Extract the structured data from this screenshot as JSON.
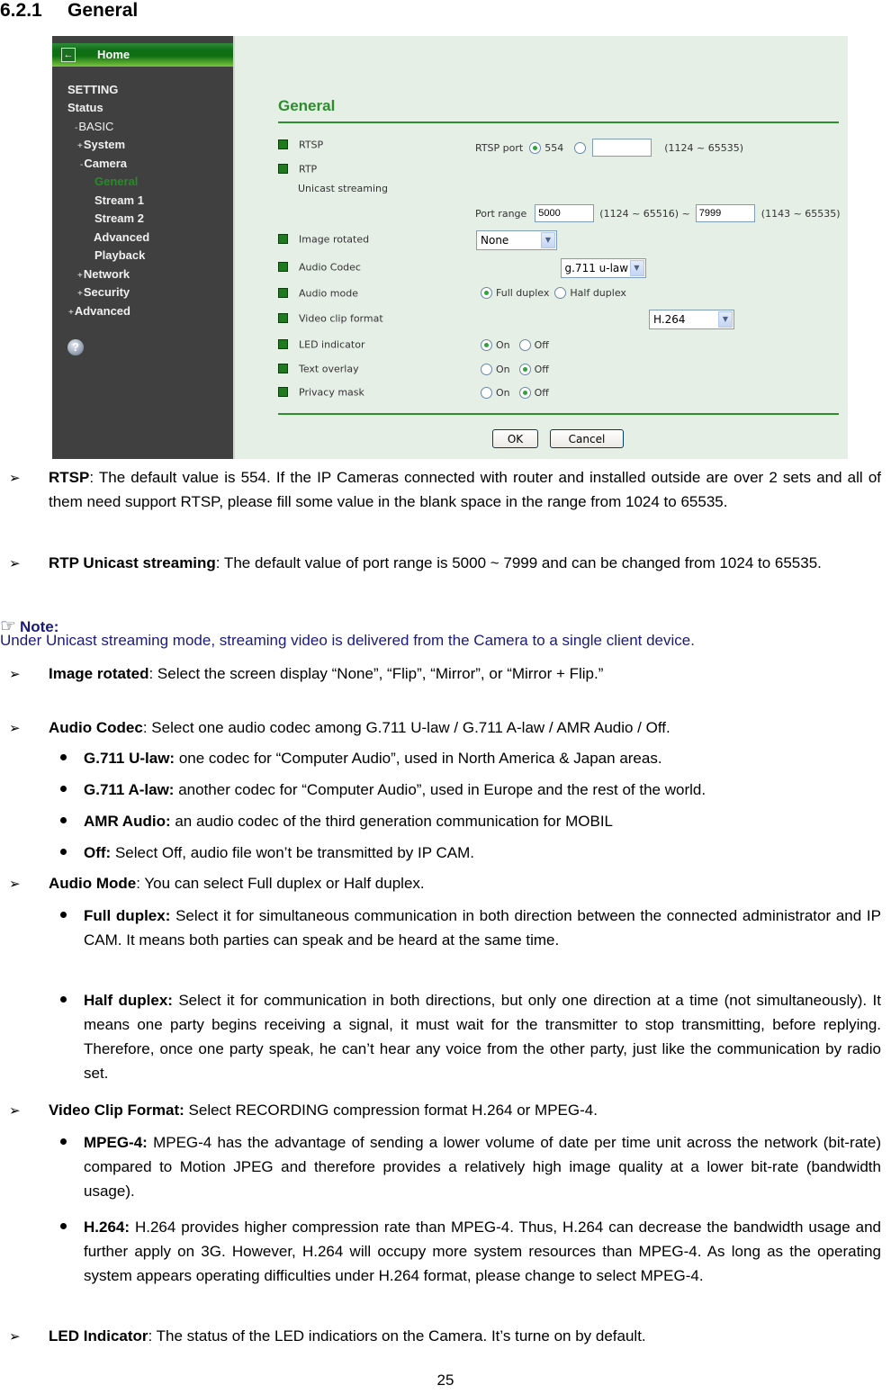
{
  "section": {
    "number": "6.2.1",
    "title": "General"
  },
  "screenshot": {
    "sidebar": {
      "home_label": "Home",
      "home_icon": "back-arrow-icon",
      "items": [
        {
          "prefix": "",
          "label": "SETTING",
          "active": false
        },
        {
          "prefix": "",
          "label": "Status",
          "active": false
        },
        {
          "prefix": "-",
          "label": "BASIC",
          "active": false
        },
        {
          "prefix": "+",
          "label": "System",
          "active": false
        },
        {
          "prefix": "-",
          "label": "Camera",
          "active": false
        },
        {
          "prefix": "",
          "label": "General",
          "active": true
        },
        {
          "prefix": "",
          "label": "Stream 1",
          "active": false
        },
        {
          "prefix": "",
          "label": "Stream 2",
          "active": false
        },
        {
          "prefix": "",
          "label": "Advanced",
          "active": false
        },
        {
          "prefix": "",
          "label": "Playback",
          "active": false
        },
        {
          "prefix": "+",
          "label": "Network",
          "active": false
        },
        {
          "prefix": "+",
          "label": "Security",
          "active": false
        },
        {
          "prefix": "+",
          "label": "Advanced",
          "active": false
        }
      ],
      "help_icon": "help-question-icon",
      "help_glyph": "?"
    },
    "form": {
      "heading": "General",
      "rtsp": {
        "label": "RTSP",
        "port_label": "RTSP port",
        "default_port": "554",
        "default_selected": true,
        "custom_value": "",
        "range_hint": "(1124 ~ 65535)"
      },
      "rtp": {
        "label": "RTP",
        "sub_label": "Unicast streaming",
        "port_range_label": "Port range",
        "start": "5000",
        "start_hint": "(1124 ~ 65516) ~",
        "end": "7999",
        "end_hint": "(1143 ~ 65535)"
      },
      "image_rotated": {
        "label": "Image rotated",
        "value": "None"
      },
      "audio_codec": {
        "label": "Audio Codec",
        "value": "g.711 u-law"
      },
      "audio_mode": {
        "label": "Audio mode",
        "options": [
          "Full duplex",
          "Half duplex"
        ],
        "selected": "Full duplex"
      },
      "video_clip_format": {
        "label": "Video clip format",
        "value": "H.264"
      },
      "led_indicator": {
        "label": "LED indicator",
        "on_label": "On",
        "off_label": "Off",
        "selected": "On"
      },
      "text_overlay": {
        "label": "Text overlay",
        "on_label": "On",
        "off_label": "Off",
        "selected": "Off"
      },
      "privacy_mask": {
        "label": "Privacy mask",
        "on_label": "On",
        "off_label": "Off",
        "selected": "Off"
      },
      "ok_label": "OK",
      "cancel_label": "Cancel",
      "select_arrow": "▼"
    }
  },
  "body": {
    "arrow_glyph": "➢",
    "rtsp": {
      "term": "RTSP",
      "text": ": The default value is 554. If the IP Cameras connected with router and installed outside are over 2 sets and all of them need support RTSP, please fill some value in the blank space in the range from 1024 to 65535."
    },
    "rtp": {
      "term": "RTP Unicast streaming",
      "text": ": The default value of port range is 5000 ~ 7999 and can be changed from 1024 to 65535."
    },
    "note": {
      "icon": "pointing-hand-icon",
      "icon_glyph": "☞",
      "title": "Note:",
      "text": "Under Unicast streaming mode, streaming video is delivered from the Camera to a single client device."
    },
    "image_rotated": {
      "term": "Image rotated",
      "text": ": Select the screen display “None”, “Flip”, “Mirror”, or “Mirror + Flip.”"
    },
    "audio_codec": {
      "term": "Audio Codec",
      "text": ": Select one audio codec among G.711 U-law / G.711 A-law / AMR Audio / Off.",
      "items": [
        {
          "term": "G.711 U-law:",
          "text": " one codec for “Computer Audio”, used in North America & Japan areas."
        },
        {
          "term": "G.711 A-law:",
          "text": " another codec for “Computer Audio”, used in Europe and the rest of the world."
        },
        {
          "term": "AMR Audio:",
          "text": " an audio codec of the third generation communication for MOBIL"
        },
        {
          "term": "Off:",
          "text": " Select Off, audio file won’t be transmitted by IP CAM."
        }
      ]
    },
    "audio_mode": {
      "term": "Audio Mode",
      "text": ": You can select Full duplex or Half duplex.",
      "items": [
        {
          "term": "Full duplex:",
          "text": " Select it for simultaneous communication in both direction between the connected administrator and IP CAM. It means both parties can speak and be heard at the same time."
        },
        {
          "term": "Half duplex:",
          "text": " Select it for communication in both directions, but only one direction at a time (not simultaneously). It means one party begins receiving a signal, it must wait for the transmitter to stop transmitting, before replying. Therefore, once one party speak, he can’t hear any voice from the other party, just like the communication by radio set."
        }
      ]
    },
    "video_clip_format": {
      "term": "Video Clip Format:",
      "text": " Select RECORDING compression format H.264 or MPEG-4.",
      "items": [
        {
          "term": "MPEG-4:",
          "text": " MPEG-4 has the advantage of sending a lower volume of date per time unit across the network (bit-rate) compared to Motion JPEG and therefore provides a relatively high image quality at a lower bit-rate (bandwidth usage)."
        },
        {
          "term": "H.264:",
          "text": " H.264 provides higher compression rate than MPEG-4. Thus, H.264 can decrease the bandwidth usage and further apply on 3G. However, H.264 will occupy more system resources than MPEG-4. As long as the operating system appears operating difficulties under H.264 format, please change to select MPEG-4."
        }
      ]
    },
    "led_indicator": {
      "term": "LED Indicator",
      "text": ": The status of the LED indicatiors on the Camera. It’s turne on by default."
    }
  },
  "page_number": "25"
}
